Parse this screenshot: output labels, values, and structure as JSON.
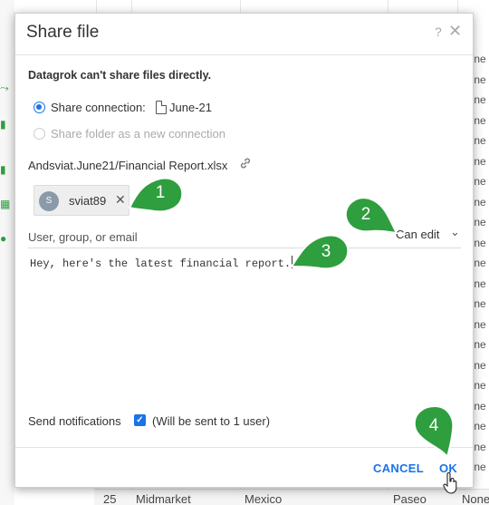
{
  "background": {
    "row_number": "25",
    "cells": [
      "Midmarket",
      "Mexico",
      "Paseo",
      "None"
    ],
    "right_column_value": "None"
  },
  "dialog": {
    "title": "Share file",
    "help_label": "?",
    "close_label": "✕",
    "warning": "Datagrok can't share files directly.",
    "options": {
      "share_connection_label": "Share connection:",
      "connection_name": "June-21",
      "share_folder_label": "Share folder as a new connection"
    },
    "file_path": "Andsviat.June21/Financial Report.xlsx",
    "recipient": {
      "initial": "S",
      "name": "sviat89",
      "remove_label": "✕"
    },
    "user_input": {
      "placeholder": "User, group, or email",
      "value": ""
    },
    "permission": {
      "selected": "Can edit",
      "chevron": "⌄"
    },
    "message": "Hey, here's the latest financial report.",
    "notifications": {
      "label": "Send notifications",
      "checked": true,
      "check_glyph": "✓",
      "note": "(Will be sent to 1 user)"
    },
    "buttons": {
      "cancel": "CANCEL",
      "ok": "OK"
    }
  },
  "callouts": [
    "1",
    "2",
    "3",
    "4"
  ],
  "colors": {
    "accent": "#1a73e8",
    "callout_green": "#2e9e3f"
  },
  "icons": [
    "help-icon",
    "close-icon",
    "file-icon",
    "link-icon",
    "chip-close-icon",
    "chevron-down-icon",
    "checkbox-icon",
    "hand-cursor-icon"
  ]
}
